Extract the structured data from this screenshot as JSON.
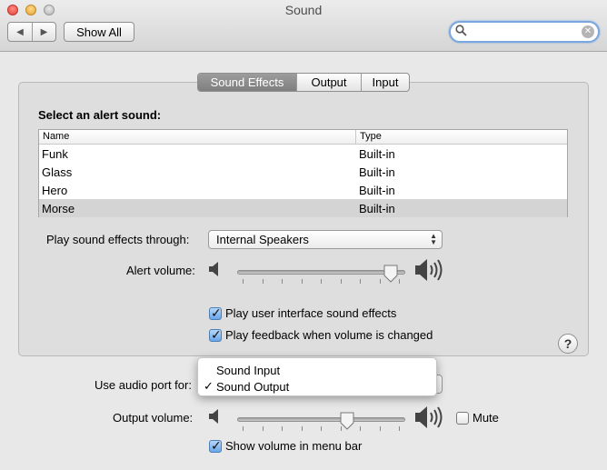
{
  "window": {
    "title": "Sound"
  },
  "toolbar": {
    "back_glyph": "◀",
    "forward_glyph": "▶",
    "show_all_label": "Show All"
  },
  "search": {
    "value": "",
    "placeholder": ""
  },
  "tabs": [
    {
      "label": "Sound Effects",
      "selected": true
    },
    {
      "label": "Output",
      "selected": false
    },
    {
      "label": "Input",
      "selected": false
    }
  ],
  "effects": {
    "section_label": "Select an alert sound:",
    "columns": {
      "name": "Name",
      "type": "Type"
    },
    "rows": [
      {
        "name": "Funk",
        "type": "Built-in"
      },
      {
        "name": "Glass",
        "type": "Built-in"
      },
      {
        "name": "Hero",
        "type": "Built-in"
      },
      {
        "name": "Morse",
        "type": "Built-in"
      }
    ],
    "selected_row": "Morse",
    "play_through_label": "Play sound effects through:",
    "play_through_value": "Internal Speakers",
    "alert_volume_label": "Alert volume:",
    "alert_volume_fraction": 0.96,
    "ui_sounds_label": "Play user interface sound effects",
    "ui_sounds_checked": true,
    "feedback_label": "Play feedback when volume is changed",
    "feedback_checked": true,
    "help_label": "?"
  },
  "bottom": {
    "audio_port_label": "Use audio port for:",
    "port_menu": [
      {
        "label": "Sound Input",
        "checked": false
      },
      {
        "label": "Sound Output",
        "checked": true
      }
    ],
    "output_volume_label": "Output volume:",
    "output_volume_fraction": 0.67,
    "mute_label": "Mute",
    "mute_checked": false,
    "menu_bar_label": "Show volume in menu bar",
    "menu_bar_checked": true
  },
  "icons": {
    "speaker_low": "speaker-low-icon",
    "speaker_high": "speaker-high-icon",
    "search": "search-icon",
    "clear": "clear-icon"
  },
  "colors": {
    "search_focus": "#7aa7e0",
    "selected_tab": "#8a8a8a",
    "selected_row": "#d4d4d4"
  }
}
